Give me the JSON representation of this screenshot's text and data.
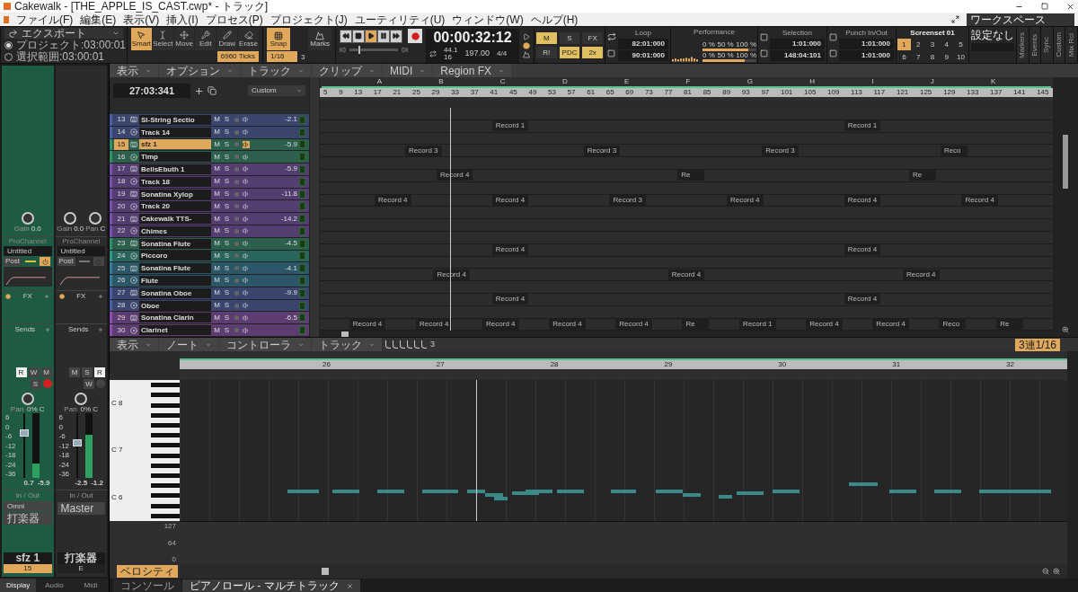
{
  "window": {
    "title": "Cakewalk - [THE_APPLE_IS_CAST.cwp* - トラック]"
  },
  "menu": [
    "ファイル(F)",
    "編集(E)",
    "表示(V)",
    "挿入(I)",
    "プロセス(P)",
    "プロジェクト(J)",
    "ユーティリティ(U)",
    "ウィンドウ(W)",
    "ヘルプ(H)"
  ],
  "workspace": "ワークスペース",
  "export": {
    "label": "エクスポート",
    "options": [
      {
        "label": "プロジェクト:03:00:01",
        "selected": true
      },
      {
        "label": "選択範囲:03:00:01",
        "selected": false
      }
    ]
  },
  "tools": {
    "items": [
      {
        "kind": "smart",
        "label": "Smart",
        "selected": true
      },
      {
        "kind": "select",
        "label": "Select",
        "selected": false
      },
      {
        "kind": "move",
        "label": "Move",
        "selected": false
      },
      {
        "kind": "edit",
        "label": "Edit",
        "selected": false
      },
      {
        "kind": "draw",
        "label": "Draw",
        "selected": false
      },
      {
        "kind": "erase",
        "label": "Erase",
        "selected": false
      }
    ],
    "ticks": "6960 Ticks"
  },
  "snap": {
    "label": "Snap",
    "value": "1/16",
    "marks": "Marks",
    "count": "3"
  },
  "transport": {
    "buttons": [
      {
        "kind": "rewind",
        "selected": false
      },
      {
        "kind": "stop",
        "selected": false
      },
      {
        "kind": "play",
        "selected": true
      },
      {
        "kind": "pause",
        "selected": false
      },
      {
        "kind": "ffwd",
        "selected": false
      }
    ],
    "position": {
      "level": 0.2
    },
    "time": "00:00:32:12",
    "rate": "44.1",
    "bits": "16",
    "tempo": "197.00",
    "meter": "4/4"
  },
  "mix": [
    {
      "label": "M",
      "on": true
    },
    {
      "label": "S",
      "on": false
    },
    {
      "label": "FX",
      "on": false
    },
    {
      "label": "R!",
      "on": false
    },
    {
      "label": "PDC",
      "on": true
    },
    {
      "label": "2x",
      "on": true
    }
  ],
  "loop": {
    "title": "Loop",
    "start": "82:01:000",
    "end": "90:01:000"
  },
  "performance": {
    "title": "Performance",
    "meters": [
      {
        "scale": [
          "0 %",
          "50 %",
          "100 %"
        ],
        "level": 0.85
      },
      {
        "scale": [
          "0 %",
          "50 %",
          "100 %"
        ],
        "level": 0.78
      }
    ]
  },
  "selection": {
    "title": "Selection",
    "start": "1:01:000",
    "end": "148:04:101"
  },
  "punch": {
    "title": "Punch In/Out",
    "start": "1:01:000",
    "end": "1:01:000"
  },
  "screenset": {
    "title": "Screenset 01",
    "slots": [
      {
        "label": "1",
        "selected": true
      },
      {
        "label": "2",
        "selected": false
      },
      {
        "label": "3",
        "selected": false
      },
      {
        "label": "4",
        "selected": false
      },
      {
        "label": "5",
        "selected": false
      },
      {
        "label": "6",
        "selected": false
      },
      {
        "label": "7",
        "selected": false
      },
      {
        "label": "8",
        "selected": false
      },
      {
        "label": "9",
        "selected": false
      },
      {
        "label": "10",
        "selected": false
      }
    ]
  },
  "preset": "設定なし",
  "side_tabs": [
    "Markers",
    "Events",
    "Sync",
    "Custom",
    "Mix Rcl"
  ],
  "track_view": {
    "menus": [
      "表示",
      "オプション",
      "トラック",
      "クリップ",
      "MIDI",
      "Region FX"
    ],
    "now": "27:03:341",
    "preset": "Custom",
    "markers": [
      "A",
      "B",
      "C",
      "D",
      "E",
      "F",
      "G",
      "H",
      "I",
      "J",
      "K"
    ],
    "ruler": [
      "5",
      "9",
      "13",
      "17",
      "21",
      "25",
      "29",
      "33",
      "37",
      "41",
      "45",
      "49",
      "53",
      "57",
      "61",
      "65",
      "69",
      "73",
      "77",
      "81",
      "85",
      "89",
      "93",
      "97",
      "101",
      "105",
      "109",
      "113",
      "117",
      "121",
      "125",
      "129",
      "133",
      "137",
      "141",
      "145"
    ],
    "tracks": [
      {
        "number": "13",
        "name": "SI-String Sectio",
        "kind": "instrument",
        "mute": "M",
        "solo": "S",
        "volume": "-2.1",
        "color": "#4a5fa8",
        "selected": false
      },
      {
        "number": "14",
        "name": "Track 14",
        "kind": "midi",
        "mute": "M",
        "solo": "S",
        "color": "#4a5fa8",
        "selected": false,
        "clips": [
          "Record 1",
          "Record 1"
        ]
      },
      {
        "number": "15",
        "name": "sfz 1",
        "kind": "instrument",
        "mute": "M",
        "solo": "S",
        "volume": "-5.9",
        "color": "#2f8f6a",
        "selected": true
      },
      {
        "number": "16",
        "name": "Timp",
        "kind": "midi",
        "mute": "M",
        "solo": "S",
        "color": "#2f8f6a",
        "selected": false,
        "clips": [
          "Record 3",
          "Record 3",
          "Record 3",
          "Reco"
        ]
      },
      {
        "number": "17",
        "name": "BellsEbuth 1",
        "kind": "instrument",
        "mute": "M",
        "solo": "S",
        "volume": "-5.9",
        "color": "#7a4fb0",
        "selected": false
      },
      {
        "number": "18",
        "name": "Track 18",
        "kind": "midi",
        "mute": "M",
        "solo": "S",
        "color": "#7a4fb0",
        "selected": false,
        "clips": [
          "Record 4",
          "Re",
          "Re"
        ]
      },
      {
        "number": "19",
        "name": "Sonatina Xylop",
        "kind": "instrument",
        "mute": "M",
        "solo": "S",
        "volume": "-11.8",
        "color": "#7a4fb0",
        "selected": false
      },
      {
        "number": "20",
        "name": "Track 20",
        "kind": "midi",
        "mute": "M",
        "solo": "S",
        "color": "#7a4fb0",
        "selected": false,
        "clips": [
          "Record 4",
          "Record 4",
          "Record 3",
          "Record 4",
          "Record 4",
          "Record 4"
        ]
      },
      {
        "number": "21",
        "name": "Cakewalk TTS-",
        "kind": "instrument",
        "mute": "M",
        "solo": "S",
        "volume": "-14.2",
        "color": "#7a4fb0",
        "selected": false
      },
      {
        "number": "22",
        "name": "Chimes",
        "kind": "midi",
        "mute": "M",
        "solo": "S",
        "color": "#7a4fb0",
        "selected": false
      },
      {
        "number": "23",
        "name": "Sonatina Flute",
        "kind": "instrument",
        "mute": "M",
        "solo": "S",
        "volume": "-4.5",
        "color": "#2f8f6a",
        "selected": false
      },
      {
        "number": "24",
        "name": "Piccoro",
        "kind": "midi",
        "mute": "M",
        "solo": "S",
        "color": "#2a9a8a",
        "selected": false,
        "clips": [
          "Record 4",
          "Record 4"
        ]
      },
      {
        "number": "25",
        "name": "Sonatina Flute",
        "kind": "instrument",
        "mute": "M",
        "solo": "S",
        "volume": "-4.1",
        "color": "#2f7fa0",
        "selected": false
      },
      {
        "number": "26",
        "name": "Flute",
        "kind": "midi",
        "mute": "M",
        "solo": "S",
        "color": "#2f7fa0",
        "selected": false,
        "clips": [
          "Record 4",
          "Record 4",
          "Record 4"
        ]
      },
      {
        "number": "27",
        "name": "Sonatina Oboe",
        "kind": "instrument",
        "mute": "M",
        "solo": "S",
        "volume": "-9.9",
        "color": "#4a5fa8",
        "selected": false
      },
      {
        "number": "28",
        "name": "Oboe",
        "kind": "midi",
        "mute": "M",
        "solo": "S",
        "color": "#4a5fa8",
        "selected": false,
        "clips": [
          "Record 4",
          "Record 4"
        ]
      },
      {
        "number": "29",
        "name": "Sonatina Clarin",
        "kind": "instrument",
        "mute": "M",
        "solo": "S",
        "volume": "-6.5",
        "color": "#8a4fb0",
        "selected": false
      },
      {
        "number": "30",
        "name": "Clarinet",
        "kind": "midi",
        "mute": "M",
        "solo": "S",
        "color": "#8a4fb0",
        "selected": false,
        "clips": [
          "Record 4",
          "Record 4",
          "Record 4",
          "Record 4",
          "Record 4",
          "Re",
          "Record 1",
          "Record 4",
          "Record 4",
          "Reco",
          "Re"
        ]
      }
    ]
  },
  "piano_roll": {
    "menus": [
      "表示",
      "ノート",
      "コントローラ",
      "トラック"
    ],
    "triplet": "3",
    "snap": "3連1/16",
    "ruler": [
      "26",
      "27",
      "28",
      "29",
      "30",
      "31",
      "32"
    ],
    "keys": [
      "C 8",
      "C 7",
      "C 6"
    ],
    "velocity": {
      "scale": [
        "127",
        "64",
        "0"
      ],
      "lane": "ベロシティ"
    }
  },
  "inspector": {
    "strips": [
      {
        "color": "#1f5a43",
        "knobs": [
          {
            "label": "Gain",
            "value": "0.0"
          }
        ],
        "prochannel": "ProChannel",
        "preset": "Untitled",
        "post": "Post",
        "power": true,
        "fx": "FX",
        "sends": "Sends",
        "buttons": [
          {
            "label": "R",
            "on": true
          },
          {
            "label": "W",
            "on": false
          },
          {
            "label": "M",
            "on": false
          },
          {
            "label": "S",
            "on": false
          }
        ],
        "armed": true,
        "pan_label": "Pan",
        "pan": "0% C",
        "scale": [
          "6",
          "0",
          "-6",
          "-12",
          "-18",
          "-24",
          "-36"
        ],
        "fader": {
          "level": 0.72
        },
        "meter": {
          "level": 0.22
        },
        "readouts": [
          "0.7",
          "-5.9"
        ],
        "io": "In / Out",
        "input": "Omni",
        "output": "打楽器",
        "name": "sfz 1",
        "number": "15"
      },
      {
        "color": "#2b2b2b",
        "knobs": [
          {
            "label": "Gain",
            "value": "0.0"
          },
          {
            "label": "Pan",
            "value": "C"
          }
        ],
        "prochannel": "ProChannel",
        "preset": "Untitled",
        "post": "Post",
        "power": false,
        "fx": "FX",
        "sends": "Sends",
        "buttons": [
          {
            "label": "M",
            "on": false
          },
          {
            "label": "S",
            "on": false
          },
          {
            "label": "R",
            "on": true
          },
          {
            "label": "W",
            "on": false
          }
        ],
        "armed": false,
        "pan_label": "Pan",
        "pan": "0% C",
        "scale": [
          "6",
          "0",
          "-6",
          "-12",
          "-18",
          "-24",
          "-36"
        ],
        "fader": {
          "level": 0.55
        },
        "meter": {
          "level": 0.66
        },
        "readouts": [
          "-2.5",
          "-1.2"
        ],
        "io": "In / Out",
        "output": "Master",
        "name": "打楽器",
        "number": "E"
      }
    ],
    "tabs": [
      {
        "label": "Display",
        "selected": true
      },
      {
        "label": "Audio",
        "selected": false
      },
      {
        "label": "Midi",
        "selected": false
      }
    ]
  },
  "bottom_tabs": [
    {
      "label": "コンソール",
      "selected": false
    },
    {
      "label": "ピアノロール - マルチトラック",
      "selected": true
    }
  ]
}
